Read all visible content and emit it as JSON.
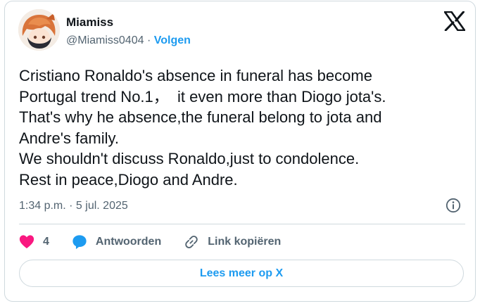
{
  "author": {
    "display_name": "Miamiss",
    "handle": "@Miamiss0404",
    "separator": "·",
    "follow_label": "Volgen"
  },
  "brand": {
    "logo_icon": "x-logo-icon"
  },
  "tweet": {
    "lines": [
      "Cristiano Ronaldo's absence in funeral has become",
      "Portugal trend No.1，  it even more than Diogo jota's.",
      "That's why he absence,the funeral belong to jota and",
      "Andre's family.",
      "We shouldn't discuss Ronaldo,just to condolence.",
      "Rest in peace,Diogo and Andre."
    ],
    "timestamp": "1:34 p.m. · 5 jul. 2025"
  },
  "actions": {
    "like_count": "4",
    "reply_label": "Antwoorden",
    "copy_link_label": "Link kopiëren"
  },
  "footer": {
    "read_more_label": "Lees meer op X"
  },
  "colors": {
    "accent": "#1d9bf0",
    "heart": "#f91880",
    "text": "#0f1419",
    "muted": "#536471",
    "border": "#cfd9de"
  },
  "icons": [
    "avatar",
    "x-logo-icon",
    "info-icon",
    "heart-icon",
    "reply-bubble-icon",
    "link-icon"
  ]
}
